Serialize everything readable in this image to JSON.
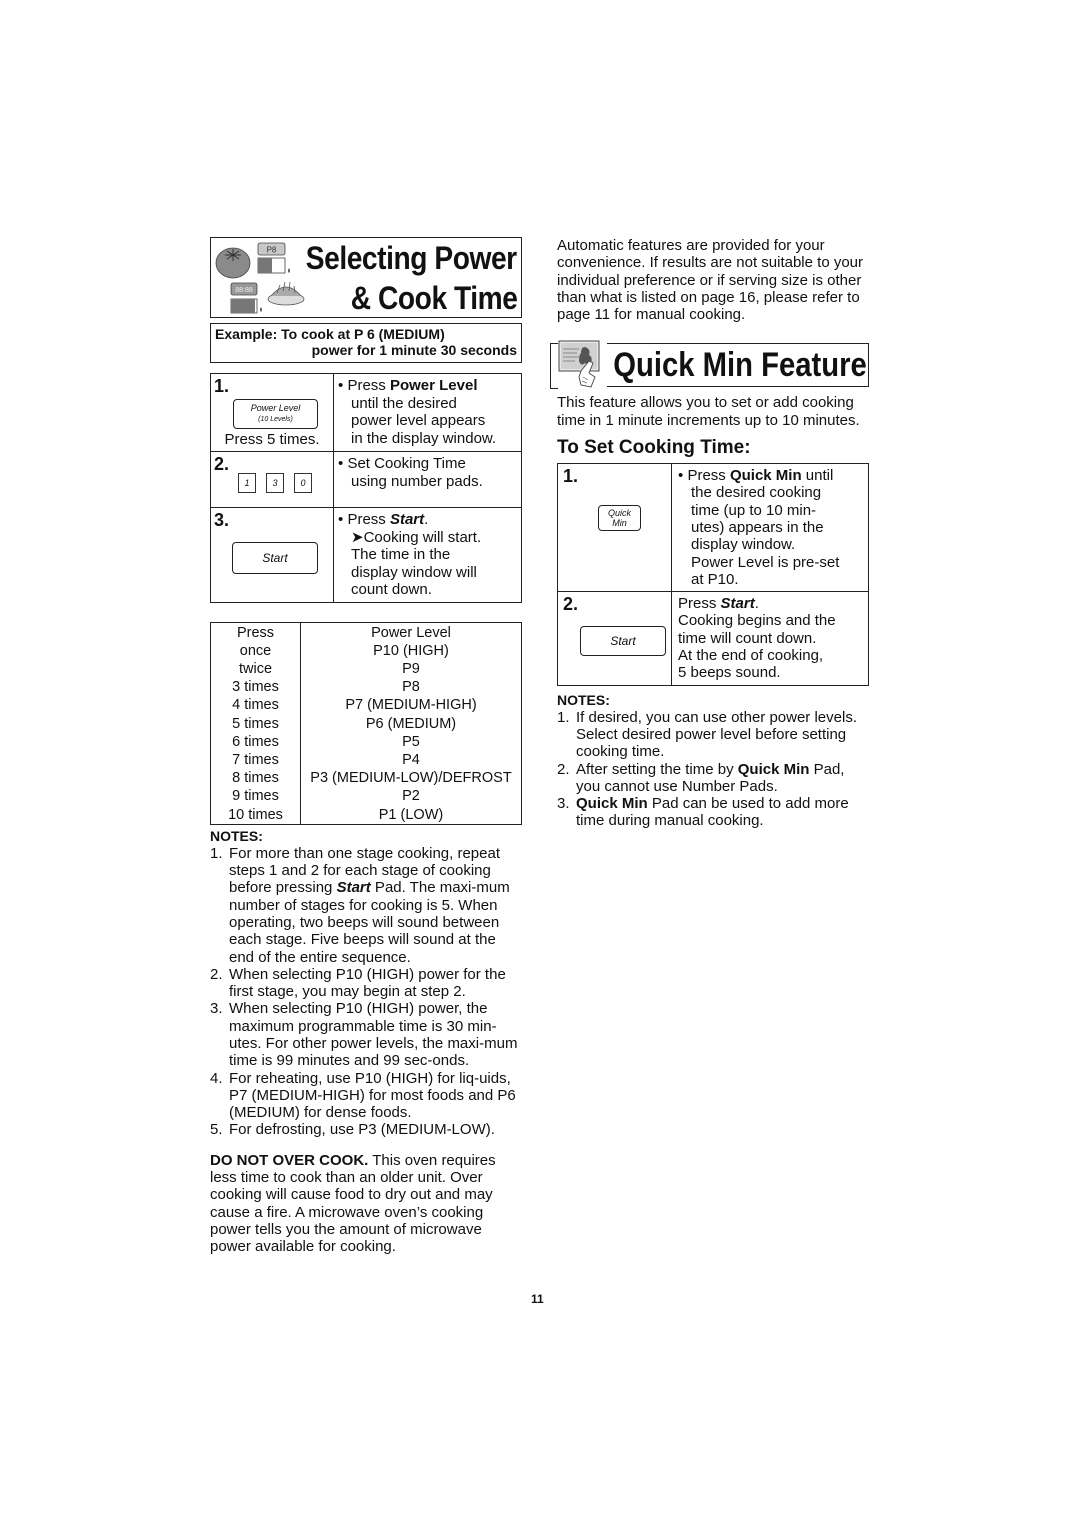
{
  "page_number": "11",
  "left": {
    "header": {
      "title_line1": "Selecting Power",
      "title_line2": "& Cook Time",
      "display_text_1": "P8",
      "display_text_2": "88:88"
    },
    "example": {
      "line1": "Example: To cook at P 6 (MEDIUM)",
      "line2": "power for 1 minute 30 seconds"
    },
    "steps": [
      {
        "number": "1.",
        "pad_label": "Power Level",
        "pad_sublabel": "(10 Levels)",
        "pad_caption": "Press 5 times.",
        "bullet": "•",
        "text_pre": "Press ",
        "text_bold": "Power Level",
        "text_rest": [
          "until the desired",
          "power level appears",
          "in the display window."
        ]
      },
      {
        "number": "2.",
        "number_pads": [
          "1",
          "3",
          "0"
        ],
        "bullet": "•",
        "text_lines": [
          "Set Cooking Time",
          "using number pads."
        ]
      },
      {
        "number": "3.",
        "pad_label": "Start",
        "bullet": "•",
        "text_pre": "Press ",
        "text_bold_italic": "Start",
        "text_post": ".",
        "arrow": "➤",
        "text_rest": [
          "Cooking will start.",
          "The time in the",
          "display window will",
          "count down."
        ]
      }
    ],
    "power_table": {
      "headers": [
        "Press",
        "Power Level"
      ],
      "rows": [
        [
          "once",
          "P10 (HIGH)"
        ],
        [
          "twice",
          "P9"
        ],
        [
          "3 times",
          "P8"
        ],
        [
          "4 times",
          "P7 (MEDIUM-HIGH)"
        ],
        [
          "5 times",
          "P6 (MEDIUM)"
        ],
        [
          "6 times",
          "P5"
        ],
        [
          "7 times",
          "P4"
        ],
        [
          "8 times",
          "P3 (MEDIUM-LOW)/DEFROST"
        ],
        [
          "9 times",
          "P2"
        ],
        [
          "10 times",
          "P1 (LOW)"
        ]
      ]
    },
    "notes_heading": "NOTES:",
    "notes": [
      {
        "num": "1.",
        "pre": "For more than one stage cooking, repeat steps 1 and 2 for each stage of cooking before pressing ",
        "bold_italic": "Start",
        "post": " Pad. The maxi-mum number of stages for cooking is 5. When operating, two beeps will sound between each stage. Five beeps will sound at the end of the entire sequence."
      },
      {
        "num": "2.",
        "text": "When selecting P10 (HIGH) power for the first stage, you may begin at step 2."
      },
      {
        "num": "3.",
        "text": "When selecting P10 (HIGH) power, the maximum programmable time is 30 min-utes. For other power levels, the maxi-mum time is 99 minutes and 99 sec-onds."
      },
      {
        "num": "4.",
        "text": "For reheating, use P10 (HIGH) for liq-uids, P7 (MEDIUM-HIGH) for most foods and P6 (MEDIUM) for dense foods."
      },
      {
        "num": "5.",
        "text": "For defrosting, use P3 (MEDIUM-LOW)."
      }
    ],
    "warning": {
      "bold": "DO NOT OVER COOK.",
      "text": " This oven requires less time to cook than an older unit. Over cooking will cause food to dry out and may cause a fire. A microwave oven’s cooking power tells you the amount of microwave power available for cooking."
    }
  },
  "right": {
    "intro": "Automatic features are provided for your convenience. If results are not suitable to your individual preference or if serving size is other than what is listed on page 16, please refer to page 11 for manual cooking.",
    "header_title": "Quick Min Feature",
    "description": "This feature allows you to set or add cooking time in 1 minute increments up to 10 minutes.",
    "subheading": "To Set Cooking Time:",
    "steps": [
      {
        "number": "1.",
        "pad_label_1": "Quick",
        "pad_label_2": "Min",
        "bullet": "•",
        "text_pre": "Press ",
        "text_bold": "Quick Min",
        "text_post": " until",
        "text_rest": [
          "the desired cooking",
          "time (up to 10 min-",
          "utes) appears in the",
          "display window.",
          "Power Level is pre-set",
          "at P10."
        ]
      },
      {
        "number": "2.",
        "pad_label": "Start",
        "text_pre": "Press ",
        "text_bold_italic": "Start",
        "text_post": ".",
        "text_rest": [
          "Cooking begins and the",
          "time will count down.",
          "At the end of cooking,",
          "5 beeps sound."
        ]
      }
    ],
    "notes_heading": "NOTES:",
    "notes": [
      {
        "num": "1.",
        "text": "If desired, you can use other power levels. Select desired power level before setting cooking time."
      },
      {
        "num": "2.",
        "pre": "After setting the time by ",
        "bold": "Quick Min",
        "post": " Pad, you cannot use Number Pads."
      },
      {
        "num": "3.",
        "pre": "",
        "bold": "Quick Min",
        "post": " Pad can be used to add more time during manual cooking."
      }
    ]
  }
}
